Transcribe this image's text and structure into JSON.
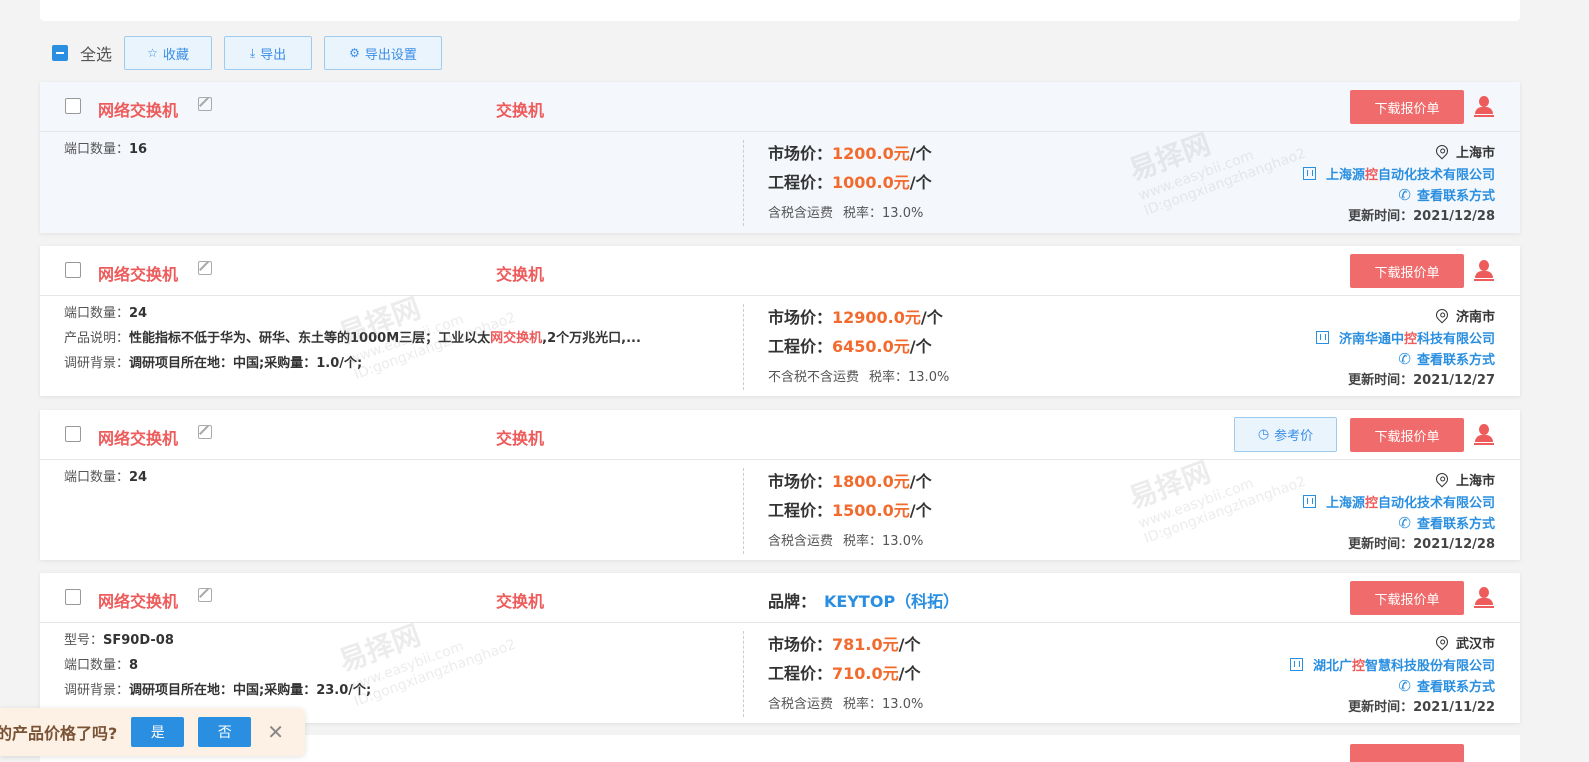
{
  "toolbar": {
    "select_all": "全选",
    "favorite": "收藏",
    "export": "导出",
    "export_settings": "导出设置"
  },
  "common": {
    "download_quote": "下载报价单",
    "market_price_label": "市场价：",
    "project_price_label": "工程价：",
    "unit": "/个",
    "contact": "查看联系方式",
    "reference_price": "参考价",
    "brand_label": "品牌："
  },
  "products": [
    {
      "name": "网络交换机",
      "category": "交换机",
      "attrs": [
        {
          "k": "端口数量：",
          "v": "16"
        }
      ],
      "market_price": "1200.0元",
      "project_price": "1000.0元",
      "tax_note": "含税含运费",
      "tax_rate": "税率：13.0%",
      "city": "上海市",
      "company_pre": "上海源",
      "company_hl": "控",
      "company_post": "自动化技术有限公司",
      "updated": "更新时间：2021/12/28"
    },
    {
      "name": "网络交换机",
      "category": "交换机",
      "attrs": [
        {
          "k": "端口数量：",
          "v": "24"
        },
        {
          "k": "产品说明：",
          "v_pre": "性能指标不低于华为、研华、东土等的1000M三层；工业以太",
          "v_hl": "网交换机",
          "v_post": ",2个万兆光口,..."
        },
        {
          "k": "调研背景：",
          "v": "调研项目所在地：中国;采购量：1.0/个;"
        }
      ],
      "market_price": "12900.0元",
      "project_price": "6450.0元",
      "tax_note": "不含税不含运费",
      "tax_rate": "税率：13.0%",
      "city": "济南市",
      "company_pre": "济南华通中",
      "company_hl": "控",
      "company_post": "科技有限公司",
      "updated": "更新时间：2021/12/27"
    },
    {
      "name": "网络交换机",
      "category": "交换机",
      "attrs": [
        {
          "k": "端口数量：",
          "v": "24"
        }
      ],
      "market_price": "1800.0元",
      "project_price": "1500.0元",
      "tax_note": "含税含运费",
      "tax_rate": "税率：13.0%",
      "city": "上海市",
      "company_pre": "上海源",
      "company_hl": "控",
      "company_post": "自动化技术有限公司",
      "updated": "更新时间：2021/12/28"
    },
    {
      "name": "网络交换机",
      "category": "交换机",
      "brand": "KEYTOP（科拓）",
      "attrs": [
        {
          "k": "型号：",
          "v": "SF90D-08"
        },
        {
          "k": "端口数量：",
          "v": "8"
        },
        {
          "k": "调研背景：",
          "v": "调研项目所在地：中国;采购量：23.0/个;"
        }
      ],
      "market_price": "781.0元",
      "project_price": "710.0元",
      "tax_note": "含税含运费",
      "tax_rate": "税率：13.0%",
      "city": "武汉市",
      "company_pre": "湖北广",
      "company_hl": "控",
      "company_post": "智慧科技股份有限公司",
      "updated": "更新时间：2021/11/22"
    }
  ],
  "watermark": {
    "logo": "易择网",
    "url": "www.easybii.com",
    "id": "ID:gongxiangzhanghao2"
  },
  "feedback": {
    "question": "的产品价格了吗?",
    "yes": "是",
    "no": "否"
  },
  "colors": {
    "accent_blue": "#2a8fe0",
    "accent_red": "#ee5b5b",
    "price_orange": "#f26a2d",
    "button_red": "#f06b6b"
  }
}
